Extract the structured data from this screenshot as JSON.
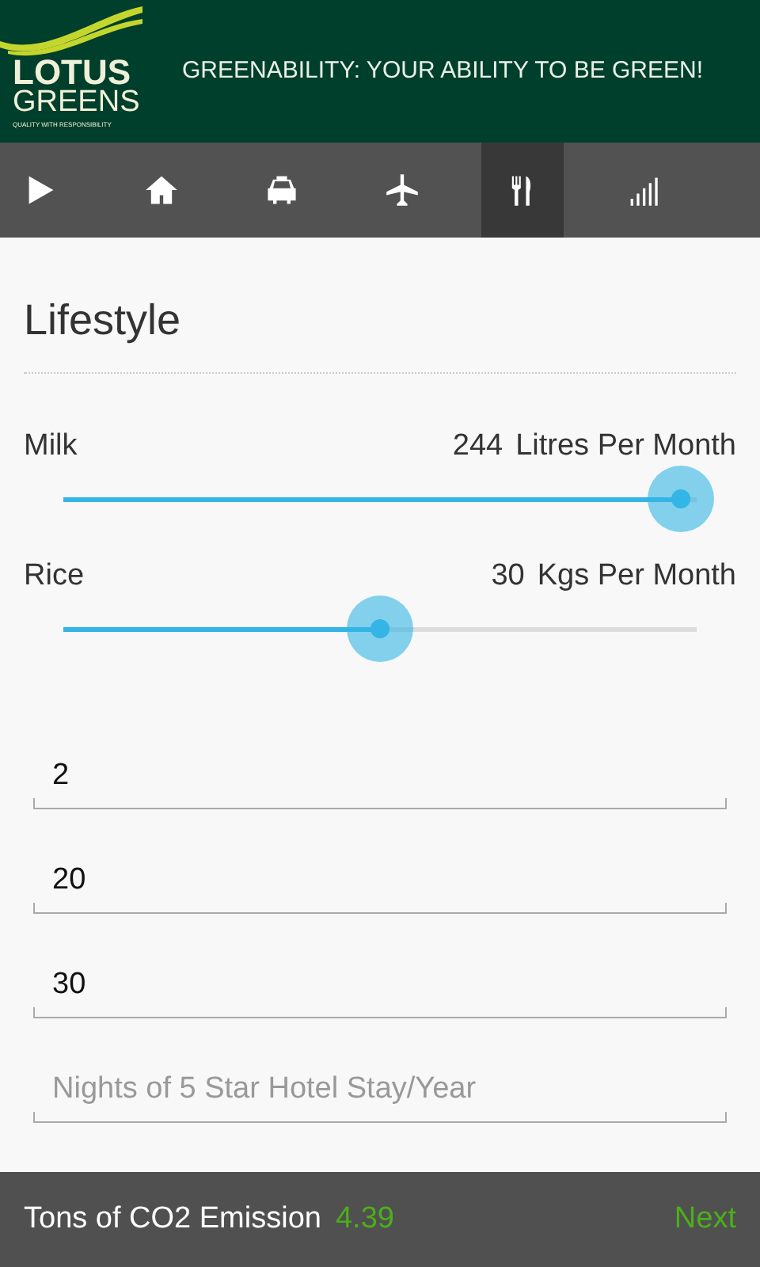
{
  "header": {
    "logo": {
      "name": "LOTUS",
      "subname": "GREENS",
      "tagline": "QUALITY WITH RESPONSIBILITY"
    },
    "title": "GREENABILITY: YOUR ABILITY TO BE GREEN!"
  },
  "tabs": [
    {
      "kind": "play",
      "selected": false
    },
    {
      "kind": "home",
      "selected": false
    },
    {
      "kind": "car",
      "selected": false
    },
    {
      "kind": "plane",
      "selected": false
    },
    {
      "kind": "food",
      "selected": true
    },
    {
      "kind": "signal",
      "selected": false
    }
  ],
  "section_title": "Lifestyle",
  "sliders": [
    {
      "label": "Milk",
      "value": "244",
      "unit": "Litres Per Month",
      "level": 0.975
    },
    {
      "label": "Rice",
      "value": "30",
      "unit": "Kgs Per Month",
      "level": 0.5
    }
  ],
  "fields": [
    {
      "value": "2"
    },
    {
      "value": "20"
    },
    {
      "value": "30"
    },
    {
      "placeholder": "Nights of 5 Star Hotel Stay/Year"
    }
  ],
  "footer": {
    "label": "Tons of CO2 Emission",
    "value": "4.39",
    "next": "Next"
  }
}
